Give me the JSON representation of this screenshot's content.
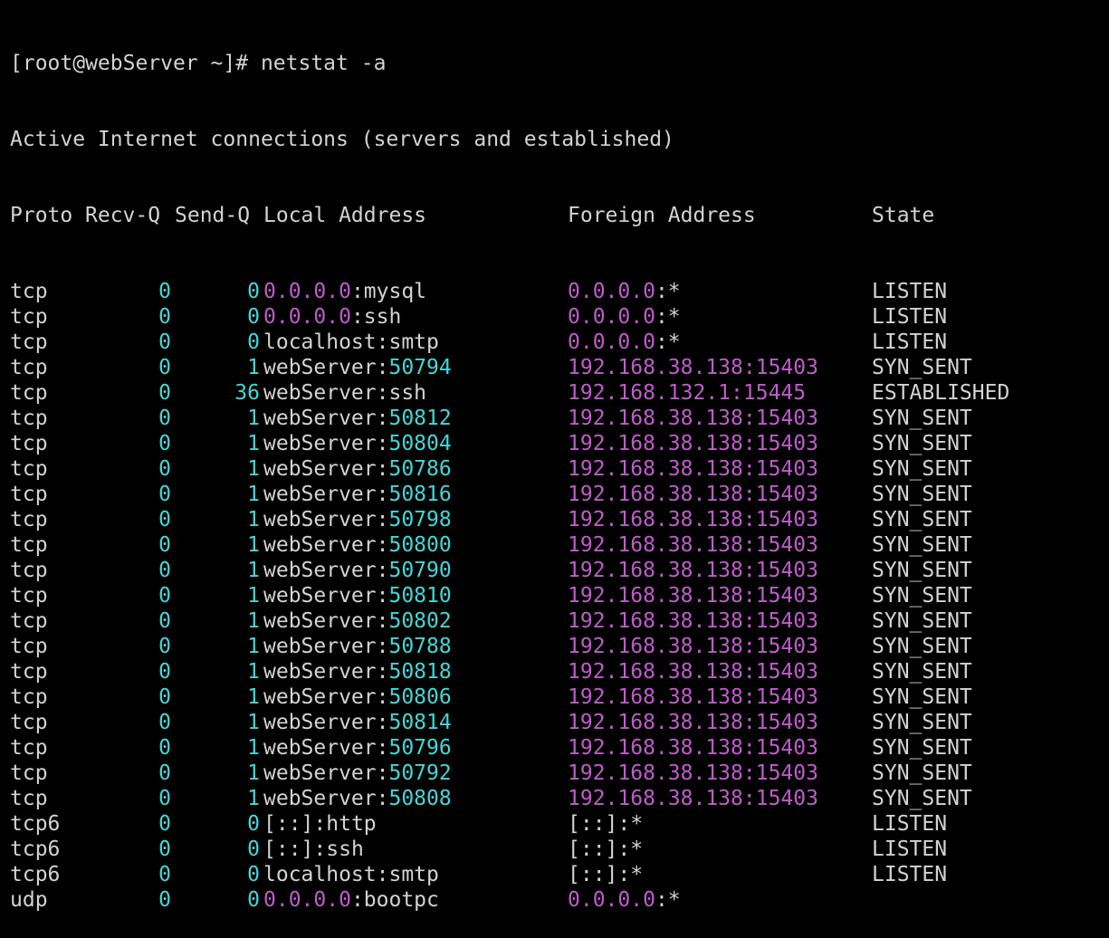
{
  "terminal": {
    "prompt": "[root@webServer ~]# netstat -a",
    "heading": "Active Internet connections (servers and established)",
    "columns": {
      "proto": "Proto",
      "recvq": "Recv-Q",
      "sendq": "Send-Q",
      "local": "Local Address",
      "foreign": "Foreign Address",
      "state": "State"
    },
    "colors": {
      "background": "#000000",
      "text": "#d3d3d3",
      "number": "#44d7d7",
      "address": "#c05ccc"
    },
    "rows": [
      {
        "proto": "tcp",
        "recvq": "0",
        "sendq": "0",
        "local_host": "0.0.0.0",
        "local_port": "mysql",
        "foreign_host": "0.0.0.0",
        "foreign_port": "*",
        "state": "LISTEN",
        "local_host_color": "addr",
        "local_port_color": "plain",
        "foreign_host_color": "addr",
        "foreign_port_color": "plain"
      },
      {
        "proto": "tcp",
        "recvq": "0",
        "sendq": "0",
        "local_host": "0.0.0.0",
        "local_port": "ssh",
        "foreign_host": "0.0.0.0",
        "foreign_port": "*",
        "state": "LISTEN",
        "local_host_color": "addr",
        "local_port_color": "plain",
        "foreign_host_color": "addr",
        "foreign_port_color": "plain"
      },
      {
        "proto": "tcp",
        "recvq": "0",
        "sendq": "0",
        "local_host": "localhost",
        "local_port": "smtp",
        "foreign_host": "0.0.0.0",
        "foreign_port": "*",
        "state": "LISTEN",
        "local_host_color": "plain",
        "local_port_color": "plain",
        "foreign_host_color": "addr",
        "foreign_port_color": "plain"
      },
      {
        "proto": "tcp",
        "recvq": "0",
        "sendq": "1",
        "local_host": "webServer",
        "local_port": "50794",
        "foreign_host": "192.168.38.138",
        "foreign_port": "15403",
        "state": "SYN_SENT",
        "local_host_color": "plain",
        "local_port_color": "num",
        "foreign_host_color": "addr",
        "foreign_port_color": "addr"
      },
      {
        "proto": "tcp",
        "recvq": "0",
        "sendq": "36",
        "local_host": "webServer",
        "local_port": "ssh",
        "foreign_host": "192.168.132.1",
        "foreign_port": "15445",
        "state": "ESTABLISHED",
        "local_host_color": "plain",
        "local_port_color": "plain",
        "foreign_host_color": "addr",
        "foreign_port_color": "addr"
      },
      {
        "proto": "tcp",
        "recvq": "0",
        "sendq": "1",
        "local_host": "webServer",
        "local_port": "50812",
        "foreign_host": "192.168.38.138",
        "foreign_port": "15403",
        "state": "SYN_SENT",
        "local_host_color": "plain",
        "local_port_color": "num",
        "foreign_host_color": "addr",
        "foreign_port_color": "addr"
      },
      {
        "proto": "tcp",
        "recvq": "0",
        "sendq": "1",
        "local_host": "webServer",
        "local_port": "50804",
        "foreign_host": "192.168.38.138",
        "foreign_port": "15403",
        "state": "SYN_SENT",
        "local_host_color": "plain",
        "local_port_color": "num",
        "foreign_host_color": "addr",
        "foreign_port_color": "addr"
      },
      {
        "proto": "tcp",
        "recvq": "0",
        "sendq": "1",
        "local_host": "webServer",
        "local_port": "50786",
        "foreign_host": "192.168.38.138",
        "foreign_port": "15403",
        "state": "SYN_SENT",
        "local_host_color": "plain",
        "local_port_color": "num",
        "foreign_host_color": "addr",
        "foreign_port_color": "addr"
      },
      {
        "proto": "tcp",
        "recvq": "0",
        "sendq": "1",
        "local_host": "webServer",
        "local_port": "50816",
        "foreign_host": "192.168.38.138",
        "foreign_port": "15403",
        "state": "SYN_SENT",
        "local_host_color": "plain",
        "local_port_color": "num",
        "foreign_host_color": "addr",
        "foreign_port_color": "addr"
      },
      {
        "proto": "tcp",
        "recvq": "0",
        "sendq": "1",
        "local_host": "webServer",
        "local_port": "50798",
        "foreign_host": "192.168.38.138",
        "foreign_port": "15403",
        "state": "SYN_SENT",
        "local_host_color": "plain",
        "local_port_color": "num",
        "foreign_host_color": "addr",
        "foreign_port_color": "addr"
      },
      {
        "proto": "tcp",
        "recvq": "0",
        "sendq": "1",
        "local_host": "webServer",
        "local_port": "50800",
        "foreign_host": "192.168.38.138",
        "foreign_port": "15403",
        "state": "SYN_SENT",
        "local_host_color": "plain",
        "local_port_color": "num",
        "foreign_host_color": "addr",
        "foreign_port_color": "addr"
      },
      {
        "proto": "tcp",
        "recvq": "0",
        "sendq": "1",
        "local_host": "webServer",
        "local_port": "50790",
        "foreign_host": "192.168.38.138",
        "foreign_port": "15403",
        "state": "SYN_SENT",
        "local_host_color": "plain",
        "local_port_color": "num",
        "foreign_host_color": "addr",
        "foreign_port_color": "addr"
      },
      {
        "proto": "tcp",
        "recvq": "0",
        "sendq": "1",
        "local_host": "webServer",
        "local_port": "50810",
        "foreign_host": "192.168.38.138",
        "foreign_port": "15403",
        "state": "SYN_SENT",
        "local_host_color": "plain",
        "local_port_color": "num",
        "foreign_host_color": "addr",
        "foreign_port_color": "addr"
      },
      {
        "proto": "tcp",
        "recvq": "0",
        "sendq": "1",
        "local_host": "webServer",
        "local_port": "50802",
        "foreign_host": "192.168.38.138",
        "foreign_port": "15403",
        "state": "SYN_SENT",
        "local_host_color": "plain",
        "local_port_color": "num",
        "foreign_host_color": "addr",
        "foreign_port_color": "addr"
      },
      {
        "proto": "tcp",
        "recvq": "0",
        "sendq": "1",
        "local_host": "webServer",
        "local_port": "50788",
        "foreign_host": "192.168.38.138",
        "foreign_port": "15403",
        "state": "SYN_SENT",
        "local_host_color": "plain",
        "local_port_color": "num",
        "foreign_host_color": "addr",
        "foreign_port_color": "addr"
      },
      {
        "proto": "tcp",
        "recvq": "0",
        "sendq": "1",
        "local_host": "webServer",
        "local_port": "50818",
        "foreign_host": "192.168.38.138",
        "foreign_port": "15403",
        "state": "SYN_SENT",
        "local_host_color": "plain",
        "local_port_color": "num",
        "foreign_host_color": "addr",
        "foreign_port_color": "addr"
      },
      {
        "proto": "tcp",
        "recvq": "0",
        "sendq": "1",
        "local_host": "webServer",
        "local_port": "50806",
        "foreign_host": "192.168.38.138",
        "foreign_port": "15403",
        "state": "SYN_SENT",
        "local_host_color": "plain",
        "local_port_color": "num",
        "foreign_host_color": "addr",
        "foreign_port_color": "addr"
      },
      {
        "proto": "tcp",
        "recvq": "0",
        "sendq": "1",
        "local_host": "webServer",
        "local_port": "50814",
        "foreign_host": "192.168.38.138",
        "foreign_port": "15403",
        "state": "SYN_SENT",
        "local_host_color": "plain",
        "local_port_color": "num",
        "foreign_host_color": "addr",
        "foreign_port_color": "addr"
      },
      {
        "proto": "tcp",
        "recvq": "0",
        "sendq": "1",
        "local_host": "webServer",
        "local_port": "50796",
        "foreign_host": "192.168.38.138",
        "foreign_port": "15403",
        "state": "SYN_SENT",
        "local_host_color": "plain",
        "local_port_color": "num",
        "foreign_host_color": "addr",
        "foreign_port_color": "addr"
      },
      {
        "proto": "tcp",
        "recvq": "0",
        "sendq": "1",
        "local_host": "webServer",
        "local_port": "50792",
        "foreign_host": "192.168.38.138",
        "foreign_port": "15403",
        "state": "SYN_SENT",
        "local_host_color": "plain",
        "local_port_color": "num",
        "foreign_host_color": "addr",
        "foreign_port_color": "addr"
      },
      {
        "proto": "tcp",
        "recvq": "0",
        "sendq": "1",
        "local_host": "webServer",
        "local_port": "50808",
        "foreign_host": "192.168.38.138",
        "foreign_port": "15403",
        "state": "SYN_SENT",
        "local_host_color": "plain",
        "local_port_color": "num",
        "foreign_host_color": "addr",
        "foreign_port_color": "addr"
      },
      {
        "proto": "tcp6",
        "recvq": "0",
        "sendq": "0",
        "local_host": "[::]",
        "local_port": "http",
        "foreign_host": "[::]",
        "foreign_port": "*",
        "state": "LISTEN",
        "local_host_color": "plain",
        "local_port_color": "plain",
        "foreign_host_color": "plain",
        "foreign_port_color": "plain"
      },
      {
        "proto": "tcp6",
        "recvq": "0",
        "sendq": "0",
        "local_host": "[::]",
        "local_port": "ssh",
        "foreign_host": "[::]",
        "foreign_port": "*",
        "state": "LISTEN",
        "local_host_color": "plain",
        "local_port_color": "plain",
        "foreign_host_color": "plain",
        "foreign_port_color": "plain"
      },
      {
        "proto": "tcp6",
        "recvq": "0",
        "sendq": "0",
        "local_host": "localhost",
        "local_port": "smtp",
        "foreign_host": "[::]",
        "foreign_port": "*",
        "state": "LISTEN",
        "local_host_color": "plain",
        "local_port_color": "plain",
        "foreign_host_color": "plain",
        "foreign_port_color": "plain"
      },
      {
        "proto": "udp",
        "recvq": "0",
        "sendq": "0",
        "local_host": "0.0.0.0",
        "local_port": "bootpc",
        "foreign_host": "0.0.0.0",
        "foreign_port": "*",
        "state": "",
        "local_host_color": "addr",
        "local_port_color": "plain",
        "foreign_host_color": "addr",
        "foreign_port_color": "plain"
      }
    ]
  }
}
